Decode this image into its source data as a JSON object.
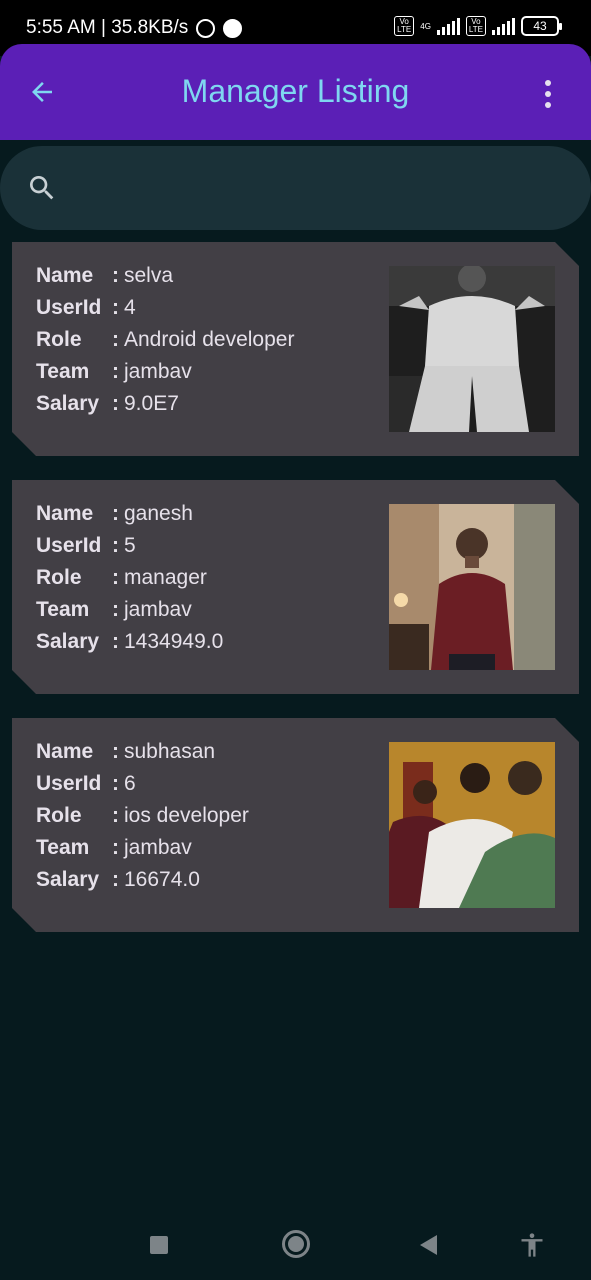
{
  "status_bar": {
    "time_speed": "5:55 AM | 35.8KB/s",
    "volte_label": "Vo\nLTE",
    "network": "4G",
    "battery": "43"
  },
  "app_bar": {
    "title": "Manager Listing",
    "back_icon": "arrow-left-icon",
    "menu_icon": "more-vert-icon",
    "color": "#5b1fb6",
    "title_color": "#7fd7f0"
  },
  "search": {
    "placeholder": "",
    "value": "",
    "icon": "search-icon"
  },
  "labels": {
    "name": "Name",
    "userid": "UserId",
    "role": "Role",
    "team": "Team",
    "salary": "Salary",
    "colon": ":"
  },
  "managers": [
    {
      "name": "selva",
      "userid": "4",
      "role": "Android developer",
      "team": "jambav",
      "salary": "9.0E7"
    },
    {
      "name": "ganesh",
      "userid": "5",
      "role": "manager",
      "team": "jambav",
      "salary": "1434949.0"
    },
    {
      "name": "subhasan",
      "userid": "6",
      "role": "ios developer",
      "team": "jambav",
      "salary": "16674.0"
    }
  ],
  "nav_bar": {
    "icons": [
      "recents-square-icon",
      "home-circle-icon",
      "back-triangle-icon",
      "accessibility-icon"
    ]
  }
}
